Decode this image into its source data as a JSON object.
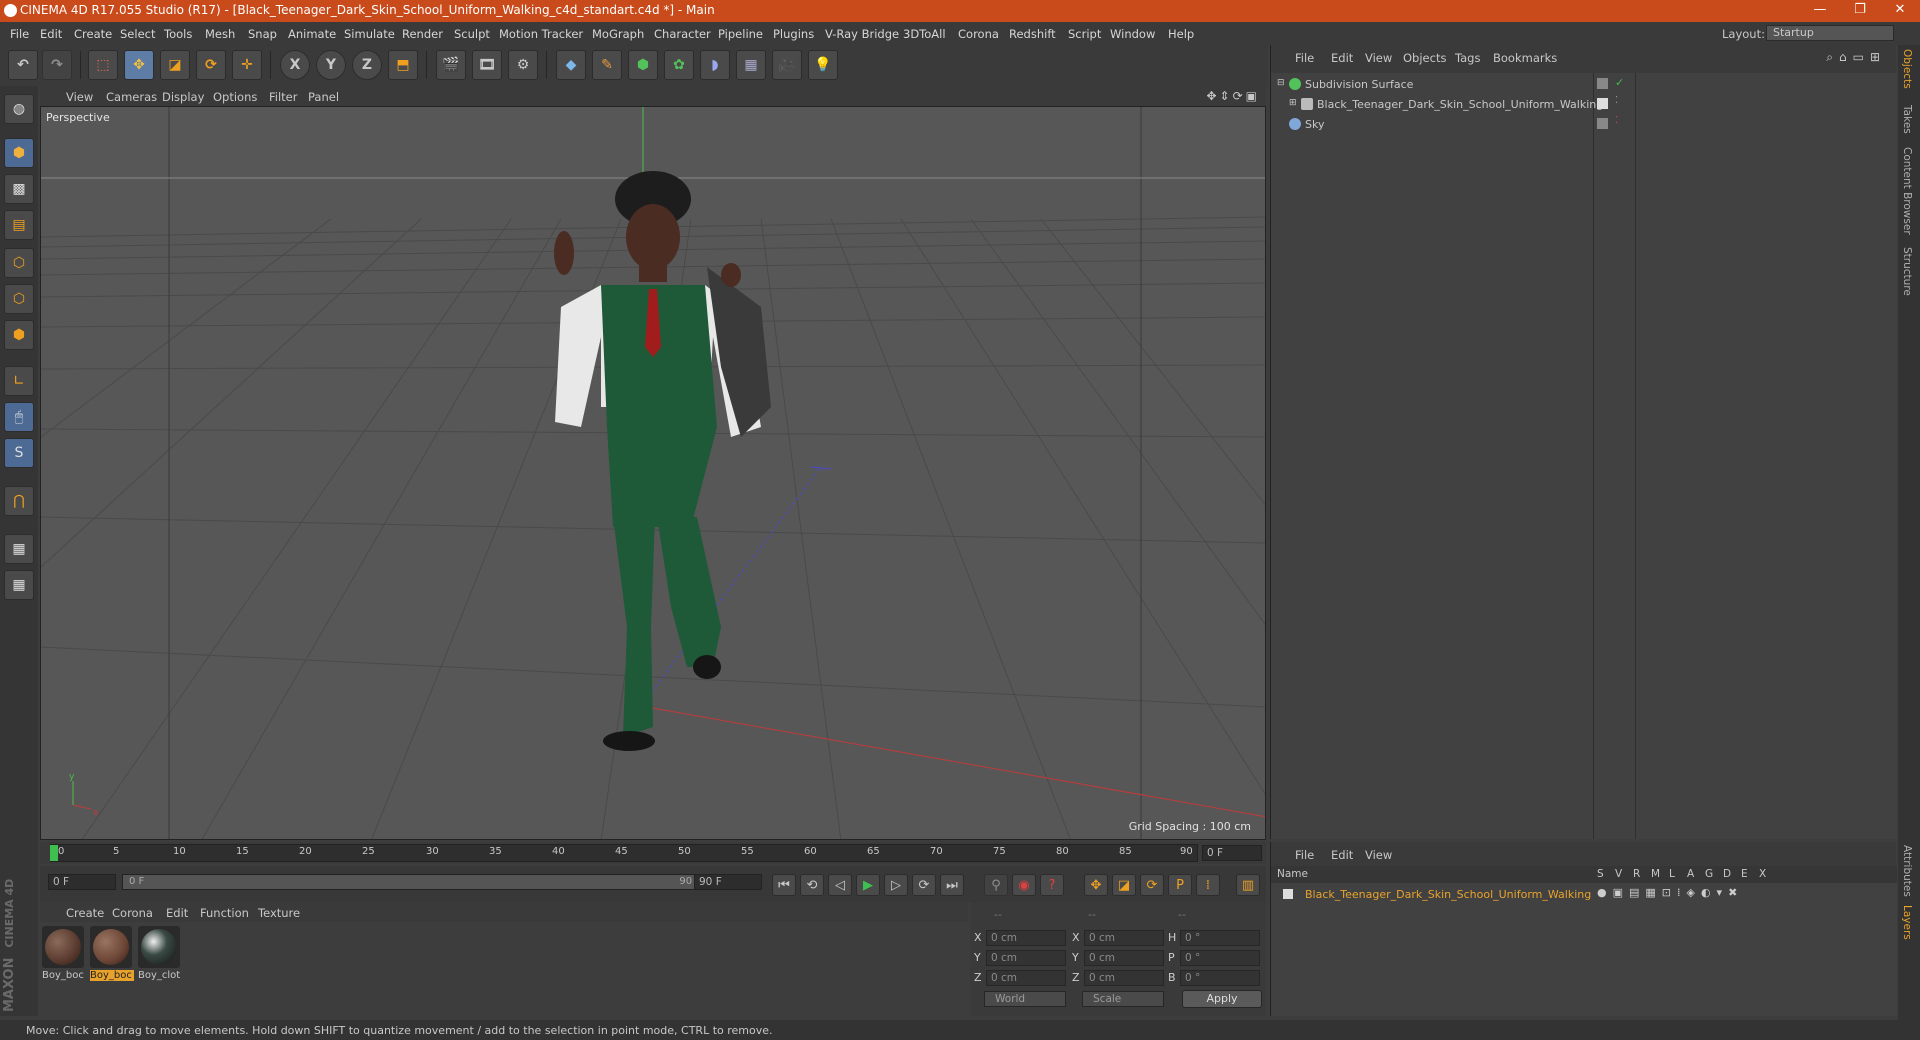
{
  "window": {
    "title": "CINEMA 4D R17.055 Studio (R17) - [Black_Teenager_Dark_Skin_School_Uniform_Walking_c4d_standart.c4d *] - Main",
    "minimize": "—",
    "maximize": "❐",
    "close": "✕"
  },
  "menubar": {
    "items": [
      "File",
      "Edit",
      "Create",
      "Select",
      "Tools",
      "Mesh",
      "Snap",
      "Animate",
      "Simulate",
      "Render",
      "Sculpt",
      "Motion Tracker",
      "MoGraph",
      "Character",
      "Pipeline",
      "Plugins",
      "V-Ray Bridge",
      "3DToAll",
      "Corona",
      "Redshift",
      "Script",
      "Window",
      "Help"
    ],
    "layout_label": "Layout:",
    "layout_value": "Startup"
  },
  "toolbar": {
    "axis_x": "X",
    "axis_y": "Y",
    "axis_z": "Z"
  },
  "viewport": {
    "menu": [
      "View",
      "Cameras",
      "Display",
      "Options",
      "Filter",
      "Panel"
    ],
    "camera_label": "Perspective",
    "grid_spacing": "Grid Spacing : 100 cm"
  },
  "timeline": {
    "ticks": [
      "0",
      "5",
      "10",
      "15",
      "20",
      "25",
      "30",
      "35",
      "40",
      "45",
      "50",
      "55",
      "60",
      "65",
      "70",
      "75",
      "80",
      "85",
      "90"
    ],
    "current_frame": "0 F",
    "start_field": "0 F",
    "range_start": "0 F",
    "range_end": "90 F",
    "end_field": "90 F",
    "playhead_frame": 0
  },
  "materials": {
    "menu": [
      "Create",
      "Corona",
      "Edit",
      "Function",
      "Texture"
    ],
    "items": [
      {
        "name": "Boy_boc",
        "color": "#5a3a2e",
        "selected": false
      },
      {
        "name": "Boy_boc",
        "color": "#6b4434",
        "selected": true
      },
      {
        "name": "Boy_clot",
        "color": "#1f2a26",
        "selected": false
      }
    ]
  },
  "coords": {
    "headers": [
      "--",
      "--",
      "--"
    ],
    "rows": [
      {
        "a": "X",
        "av": "0 cm",
        "b": "X",
        "bv": "0 cm",
        "c": "H",
        "cv": "0 °"
      },
      {
        "a": "Y",
        "av": "0 cm",
        "b": "Y",
        "bv": "0 cm",
        "c": "P",
        "cv": "0 °"
      },
      {
        "a": "Z",
        "av": "0 cm",
        "b": "Z",
        "bv": "0 cm",
        "c": "B",
        "cv": "0 °"
      }
    ],
    "mode_world": "World",
    "mode_scale": "Scale",
    "apply": "Apply"
  },
  "objects": {
    "menu": [
      "File",
      "Edit",
      "View",
      "Objects",
      "Tags",
      "Bookmarks"
    ],
    "items": [
      {
        "name": "Subdivision Surface",
        "color": "#54c25a"
      },
      {
        "name": "Black_Teenager_Dark_Skin_School_Uniform_Walking",
        "color": "#bbbbbb"
      },
      {
        "name": "Sky",
        "color": "#7fa7d8"
      }
    ]
  },
  "layers": {
    "menu": [
      "File",
      "Edit",
      "View"
    ],
    "columns": [
      "Name",
      "S",
      "V",
      "R",
      "M",
      "L",
      "A",
      "G",
      "D",
      "E",
      "X"
    ],
    "rows": [
      {
        "name": "Black_Teenager_Dark_Skin_School_Uniform_Walking"
      }
    ]
  },
  "right_tabs": [
    "Objects",
    "Takes",
    "Content Browser",
    "Structure",
    "Attributes",
    "Layers"
  ],
  "brand": {
    "line1": "MAXON",
    "line2": "CINEMA 4D"
  },
  "status": "Move: Click and drag to move elements. Hold down SHIFT to quantize movement / add to the selection in point mode, CTRL to remove."
}
